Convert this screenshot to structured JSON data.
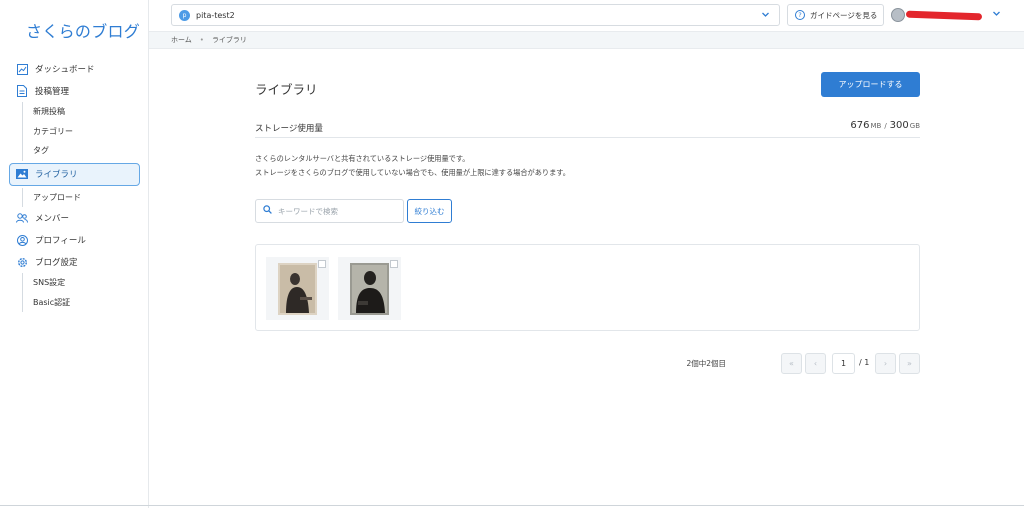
{
  "app": {
    "logo": "さくらのブログ"
  },
  "sidebar": {
    "items": [
      {
        "label": "ダッシュボード",
        "icon": "dashboard-icon"
      },
      {
        "label": "投稿管理",
        "icon": "post-icon"
      },
      {
        "label": "新規投稿"
      },
      {
        "label": "カテゴリー"
      },
      {
        "label": "タグ"
      },
      {
        "label": "ライブラリ",
        "icon": "image-icon",
        "active": true
      },
      {
        "label": "アップロード"
      },
      {
        "label": "メンバー",
        "icon": "members-icon"
      },
      {
        "label": "プロフィール",
        "icon": "profile-icon"
      },
      {
        "label": "ブログ設定",
        "icon": "gear-icon"
      },
      {
        "label": "SNS設定"
      },
      {
        "label": "Basic認証"
      }
    ]
  },
  "topbar": {
    "site_badge": "p",
    "site_name": "pita-test2",
    "guide_label": "ガイドページを見る"
  },
  "breadcrumb": {
    "home": "ホーム",
    "separator": "•",
    "current": "ライブラリ"
  },
  "main": {
    "title": "ライブラリ",
    "upload_label": "アップロードする",
    "storage": {
      "label": "ストレージ使用量",
      "used": "676",
      "used_unit": "MB",
      "separator": "/",
      "total": "300",
      "total_unit": "GB"
    },
    "description": [
      "さくらのレンタルサーバと共有されているストレージ使用量です。",
      "ストレージをさくらのブログで使用していない場合でも、使用量が上限に達する場合があります。"
    ],
    "search": {
      "placeholder": "キーワードで検索",
      "value": ""
    },
    "filter_label": "絞り込む",
    "pagination": {
      "info": "2個中2個目",
      "first": "«",
      "prev": "‹",
      "current": "1",
      "total": "/ 1",
      "next": "›",
      "last": "»"
    }
  },
  "colors": {
    "accent": "#2f7dd3",
    "active_bg": "#e9f3fc"
  }
}
